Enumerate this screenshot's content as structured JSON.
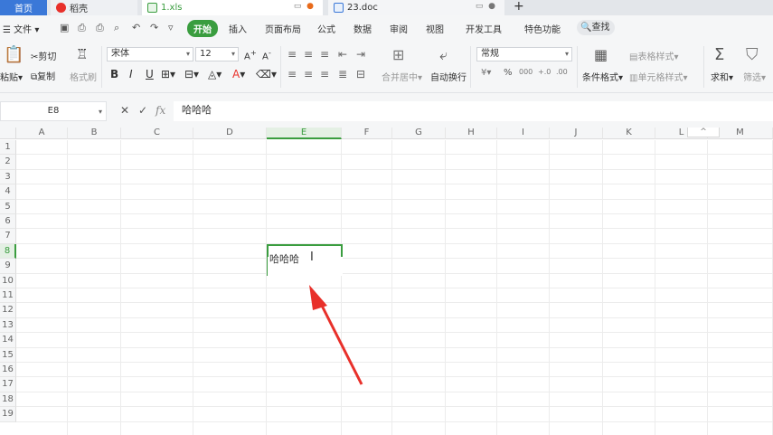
{
  "tabs": {
    "home": "首页",
    "daoke": "稻壳",
    "xls": "1.xls",
    "doc": "23.doc",
    "add": "+"
  },
  "menu": {
    "file": "文件",
    "items": [
      "开始",
      "插入",
      "页面布局",
      "公式",
      "数据",
      "审阅",
      "视图",
      "开发工具",
      "特色功能"
    ],
    "search": "查找"
  },
  "ribbon": {
    "paste": "粘贴",
    "cut": "剪切",
    "copy": "复制",
    "format_painter": "格式刷",
    "font_name": "宋体",
    "font_size": "12",
    "merge": "合并居中",
    "wrap": "自动换行",
    "number_format": "常规",
    "cond_format": "条件格式",
    "table_style": "表格样式",
    "cell_style": "单元格样式",
    "sum": "求和",
    "filter": "筛选",
    "bold": "B",
    "italic": "I",
    "underline": "U",
    "font_color": "A",
    "currency": "¥",
    "percent": "%",
    "thousands": "000",
    "inc_decimal": "+.0",
    "dec_decimal": ".00"
  },
  "formula_bar": {
    "cell_ref": "E8",
    "cancel": "✕",
    "confirm": "✓",
    "fx": "fx",
    "content": "哈哈哈"
  },
  "grid": {
    "columns": [
      "A",
      "B",
      "C",
      "D",
      "E",
      "F",
      "G",
      "H",
      "I",
      "J",
      "K",
      "L",
      "M"
    ],
    "rows": [
      "1",
      "2",
      "3",
      "4",
      "5",
      "6",
      "7",
      "8",
      "9",
      "10",
      "11",
      "12",
      "13",
      "14",
      "15",
      "16",
      "17",
      "18",
      "19"
    ],
    "selected_col": "E",
    "selected_row": "8",
    "cell_text": "哈哈哈"
  },
  "colors": {
    "accent_green": "#3a9d3f",
    "tab_blue": "#3a78d8",
    "arrow_red": "#e8302a"
  }
}
